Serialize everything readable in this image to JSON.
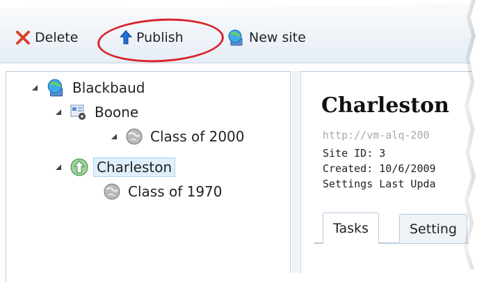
{
  "toolbar": {
    "delete_label": "Delete",
    "publish_label": "Publish",
    "new_site_label": "New site"
  },
  "tree": {
    "root": {
      "label": "Blackbaud",
      "icon": "globe-computer-icon"
    },
    "boone": {
      "label": "Boone",
      "icon": "site-settings-icon"
    },
    "boone_child": {
      "label": "Class of 2000",
      "icon": "globe-gray-icon"
    },
    "charleston": {
      "label": "Charleston",
      "icon": "globe-publish-icon",
      "selected": true
    },
    "charleston_child": {
      "label": "Class of 1970",
      "icon": "globe-gray-icon"
    }
  },
  "detail": {
    "title": "Charleston",
    "url": "http://vm-alq-200",
    "site_id": "Site ID: 3",
    "created": "Created: 10/6/2009",
    "settings_updated": "Settings Last Upda"
  },
  "tabs": [
    {
      "label": "Tasks",
      "active": true
    },
    {
      "label": "Setting",
      "active": false
    }
  ],
  "colors": {
    "accent_circle": "#d8232a",
    "selection_bg": "#dff0fb",
    "panel_border": "#b9cde0",
    "url_text": "#a8a8a8"
  }
}
